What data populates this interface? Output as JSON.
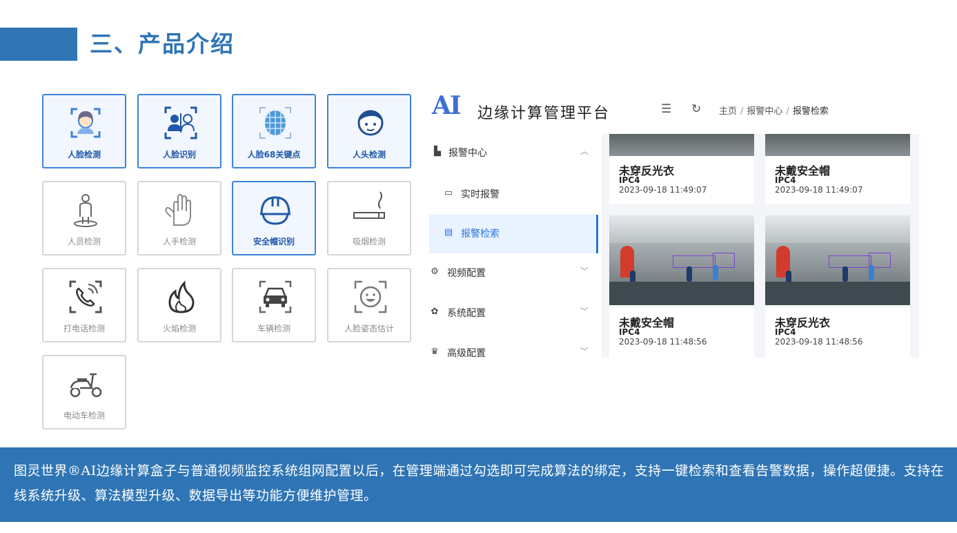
{
  "section": {
    "title": "三、产品介绍"
  },
  "algorithms": [
    {
      "label": "人脸检测",
      "icon": "face-frame-icon",
      "selected": true
    },
    {
      "label": "人脸识别",
      "icon": "face-id-icon",
      "selected": true
    },
    {
      "label": "人脸68关键点",
      "icon": "face-mesh-icon",
      "selected": true
    },
    {
      "label": "人头检测",
      "icon": "head-icon",
      "selected": true
    },
    {
      "label": "人员检测",
      "icon": "person-icon",
      "selected": false
    },
    {
      "label": "人手检测",
      "icon": "hand-icon",
      "selected": false
    },
    {
      "label": "安全帽识别",
      "icon": "helmet-icon",
      "selected": true
    },
    {
      "label": "吸烟检测",
      "icon": "cigarette-icon",
      "selected": false
    },
    {
      "label": "打电话检测",
      "icon": "phone-call-icon",
      "selected": false
    },
    {
      "label": "火焰检测",
      "icon": "flame-icon",
      "selected": false
    },
    {
      "label": "车辆检测",
      "icon": "car-icon",
      "selected": false
    },
    {
      "label": "人脸姿态估计",
      "icon": "face-pose-icon",
      "selected": false
    },
    {
      "label": "电动车检测",
      "icon": "scooter-icon",
      "selected": false
    }
  ],
  "app": {
    "logo": "AI",
    "title": "边缘计算管理平台",
    "breadcrumb": [
      "主页",
      "报警中心",
      "报警检索"
    ],
    "menu": [
      {
        "label": "报警中心",
        "icon": "alarm-icon",
        "chevron": "^"
      },
      {
        "label": "实时报警",
        "icon": "monitor-icon"
      },
      {
        "label": "报警检索",
        "icon": "list-icon"
      },
      {
        "label": "视频配置",
        "icon": "video-settings-icon",
        "chevron": "v"
      },
      {
        "label": "系统配置",
        "icon": "gear-icon",
        "chevron": "v"
      },
      {
        "label": "高级配置",
        "icon": "advanced-icon",
        "chevron": "v"
      }
    ],
    "alarms": [
      {
        "type": "未穿反光衣",
        "device": "IPC4",
        "time": "2023-09-18 11:49:07"
      },
      {
        "type": "未戴安全帽",
        "device": "IPC4",
        "time": "2023-09-18 11:49:07"
      },
      {
        "type": "未戴安全帽",
        "device": "IPC4",
        "time": "2023-09-18 11:48:56"
      },
      {
        "type": "未穿反光衣",
        "device": "IPC4",
        "time": "2023-09-18 11:48:56"
      }
    ]
  },
  "footer": {
    "text": "图灵世界®AI边缘计算盒子与普通视频监控系统组网配置以后，在管理端通过勾选即可完成算法的绑定，支持一键检索和查看告警数据，操作超便捷。支持在线系统升级、算法模型升级、数据导出等功能方便维护管理。"
  },
  "colors": {
    "brand": "#2f75b5",
    "accent": "#3c82db",
    "active_menu": "#2a73d9"
  }
}
